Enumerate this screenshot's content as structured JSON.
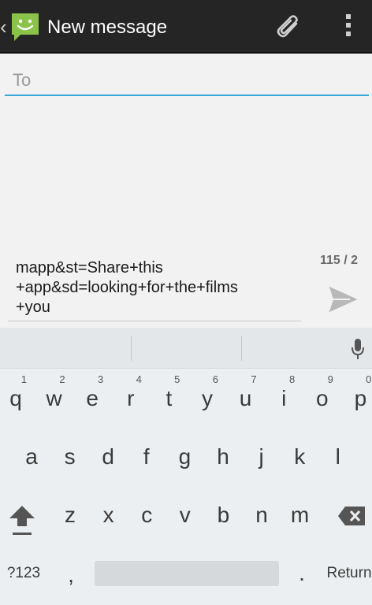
{
  "actionbar": {
    "title": "New message"
  },
  "compose": {
    "to_placeholder": "To",
    "message_text": "mapp&st=Share+this\n+app&sd=looking+for+the+films\n+you",
    "counter": "115 / 2"
  },
  "keyboard": {
    "row1": [
      {
        "label": "q",
        "hint": "1"
      },
      {
        "label": "w",
        "hint": "2"
      },
      {
        "label": "e",
        "hint": "3"
      },
      {
        "label": "r",
        "hint": "4"
      },
      {
        "label": "t",
        "hint": "5"
      },
      {
        "label": "y",
        "hint": "6"
      },
      {
        "label": "u",
        "hint": "7"
      },
      {
        "label": "i",
        "hint": "8"
      },
      {
        "label": "o",
        "hint": "9"
      },
      {
        "label": "p",
        "hint": "0"
      }
    ],
    "row2": [
      "a",
      "s",
      "d",
      "f",
      "g",
      "h",
      "j",
      "k",
      "l"
    ],
    "row3": [
      "z",
      "x",
      "c",
      "v",
      "b",
      "n",
      "m"
    ],
    "symbols_label": "?123",
    "comma_label": ",",
    "period_label": ".",
    "return_label": "Return"
  },
  "colors": {
    "accent": "#33a5d6",
    "actionbar": "#252525",
    "app_icon": "#8bc34a"
  }
}
